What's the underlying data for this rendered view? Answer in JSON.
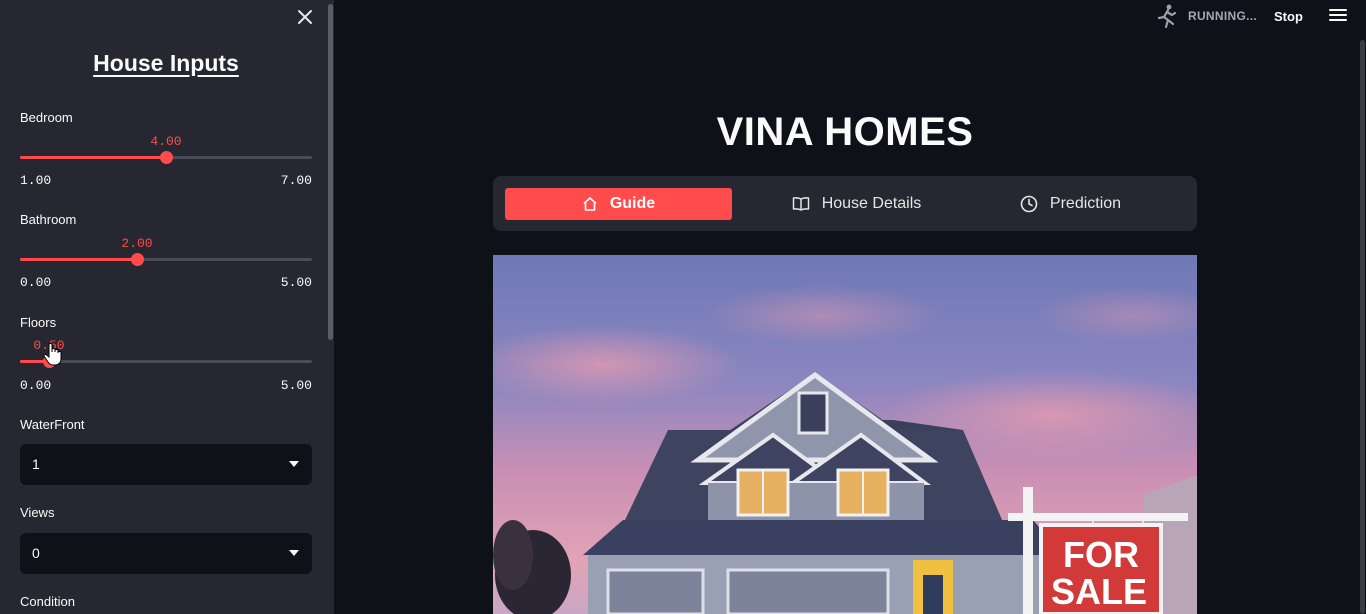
{
  "sidebar": {
    "title": "House Inputs",
    "sliders": [
      {
        "label": "Bedroom",
        "value": "4.00",
        "min": "1.00",
        "max": "7.00",
        "fraction": 0.5
      },
      {
        "label": "Bathroom",
        "value": "2.00",
        "min": "0.00",
        "max": "5.00",
        "fraction": 0.4
      },
      {
        "label": "Floors",
        "value": "0.50",
        "min": "0.00",
        "max": "5.00",
        "fraction": 0.1
      }
    ],
    "selects": [
      {
        "label": "WaterFront",
        "value": "1"
      },
      {
        "label": "Views",
        "value": "0"
      }
    ],
    "next_label": "Condition"
  },
  "status": {
    "running_text": "RUNNING...",
    "stop_label": "Stop"
  },
  "main": {
    "title": "VINA HOMES",
    "tabs": [
      {
        "label": "Guide",
        "icon": "home-icon",
        "active": true
      },
      {
        "label": "House Details",
        "icon": "book-icon",
        "active": false
      },
      {
        "label": "Prediction",
        "icon": "clock-icon",
        "active": false
      }
    ],
    "hero_sign": [
      "FOR",
      "SALE"
    ]
  },
  "colors": {
    "accent": "#ff4b4b",
    "background": "#0e1117",
    "sidebar": "#262730"
  }
}
